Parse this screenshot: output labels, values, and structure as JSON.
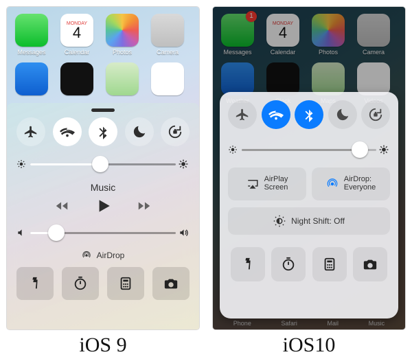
{
  "captions": {
    "left": "iOS 9",
    "right": "iOS10"
  },
  "calendar": {
    "weekday": "Monday",
    "day": "4"
  },
  "ios9": {
    "home_apps": [
      {
        "name": "Messages",
        "tile": "t-messages"
      },
      {
        "name": "Calendar",
        "tile": "t-calendar"
      },
      {
        "name": "Photos",
        "tile": "t-photos"
      },
      {
        "name": "Camera",
        "tile": "t-camera"
      }
    ],
    "toggles": [
      {
        "id": "airplane",
        "on": false
      },
      {
        "id": "wifi",
        "on": true
      },
      {
        "id": "bluetooth",
        "on": true
      },
      {
        "id": "dnd",
        "on": false
      },
      {
        "id": "lock",
        "on": false
      }
    ],
    "brightness_pct": 48,
    "music_label": "Music",
    "volume_pct": 18,
    "airdrop_label": "AirDrop",
    "shortcuts": [
      "flashlight",
      "timer",
      "calculator",
      "camera"
    ]
  },
  "ios10": {
    "badge_messages": "1",
    "home_apps_row1": [
      {
        "name": "Messages",
        "tile": "t-messages"
      },
      {
        "name": "Calendar",
        "tile": "t-calendar"
      },
      {
        "name": "Photos",
        "tile": "t-photos"
      },
      {
        "name": "Camera",
        "tile": "t-camera"
      }
    ],
    "home_apps_row2": [
      {
        "name": "Weather",
        "tile": "t-weather"
      },
      {
        "name": "Clock",
        "tile": "t-clock"
      },
      {
        "name": "Maps",
        "tile": "t-maps"
      },
      {
        "name": "Videos",
        "tile": "t-videos"
      }
    ],
    "dock_labels": [
      "Phone",
      "Safari",
      "Mail",
      "Music"
    ],
    "toggles": [
      {
        "id": "airplane",
        "on": false
      },
      {
        "id": "wifi",
        "on": true
      },
      {
        "id": "bluetooth",
        "on": true
      },
      {
        "id": "dnd",
        "on": false
      },
      {
        "id": "lock",
        "on": false
      }
    ],
    "brightness_pct": 88,
    "airplay": {
      "l1": "AirPlay",
      "l2": "Screen"
    },
    "airdrop": {
      "l1": "AirDrop:",
      "l2": "Everyone"
    },
    "night_shift_label": "Night Shift: Off",
    "shortcuts": [
      "flashlight",
      "timer",
      "calculator",
      "camera"
    ]
  }
}
